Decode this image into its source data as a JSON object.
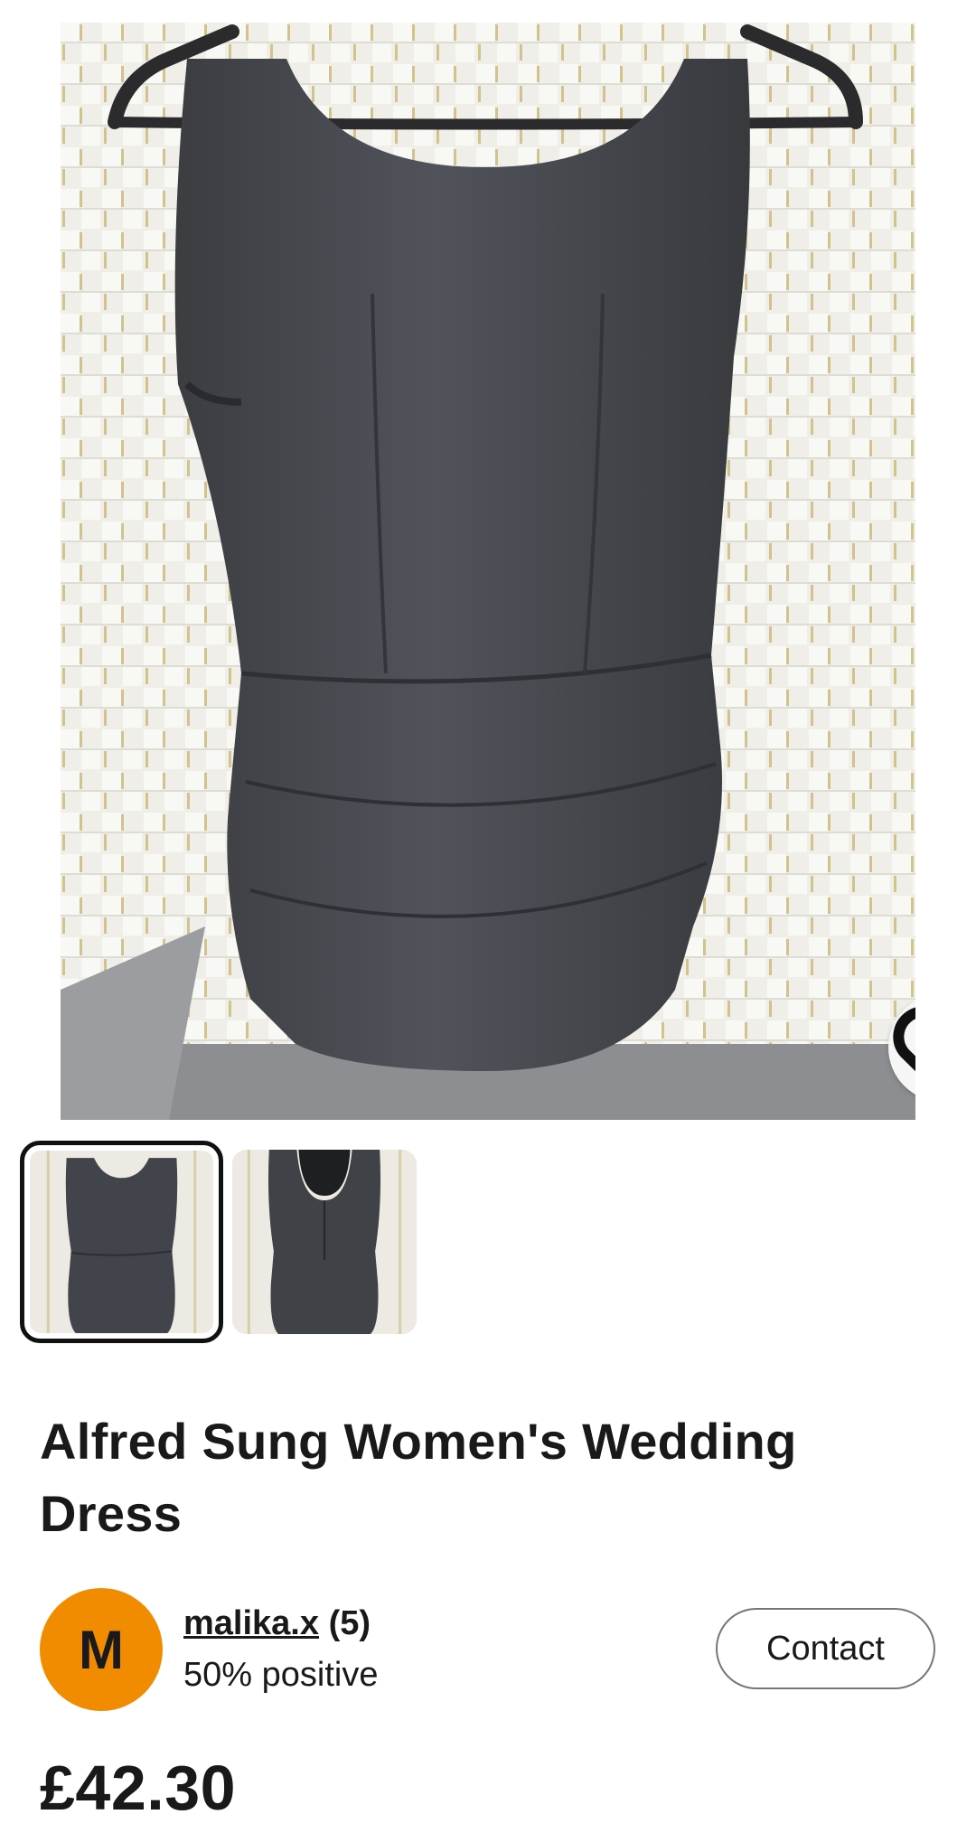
{
  "listing": {
    "title": "Alfred Sung Women's Wedding Dress",
    "price": "£42.30"
  },
  "seller": {
    "avatar_initial": "M",
    "avatar_color": "#f18c00",
    "name": "malika.x",
    "feedback_count": "(5)",
    "feedback_percent": "50% positive",
    "contact_label": "Contact"
  },
  "gallery": {
    "image_count": 2,
    "selected_index": 0,
    "favorite_icon": "heart-outline-icon"
  }
}
